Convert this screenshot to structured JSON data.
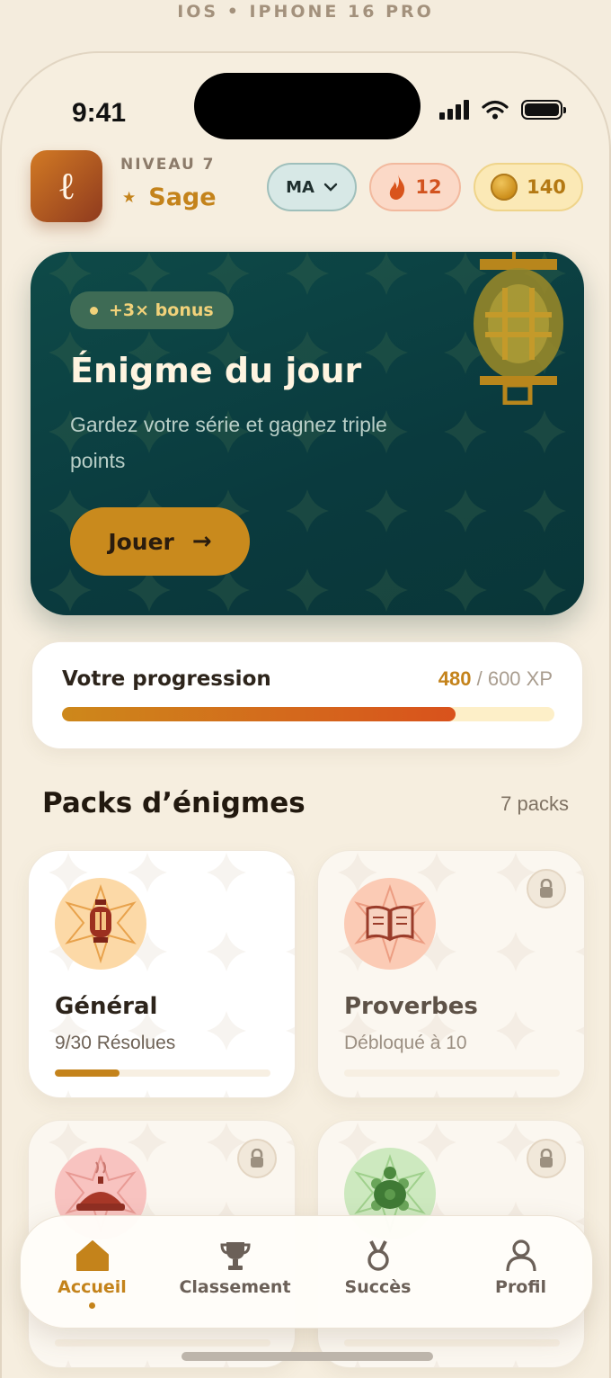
{
  "device_caption": "IOS • IPHONE 16 PRO",
  "status_bar": {
    "time": "9:41"
  },
  "header": {
    "avatar_letter": "ℓ",
    "level_label": "NIVEAU 7",
    "rank_star": "★",
    "rank_name": "Sage",
    "language": "MA",
    "streak": "12",
    "coins": "140"
  },
  "hero": {
    "badge": "+3× bonus",
    "title": "Énigme du jour",
    "subtitle": "Gardez votre série et gagnez triple points",
    "play_label": "Jouer",
    "play_arrow": "→"
  },
  "progress": {
    "title": "Votre progression",
    "current": "480",
    "separator": " / ",
    "total": "600 XP",
    "fraction": 0.8
  },
  "packs_section": {
    "title": "Packs d’énigmes",
    "count": "7 packs"
  },
  "packs": [
    {
      "name": "Général",
      "status": "9/30 Résolues",
      "progress": 0.3,
      "locked": false,
      "icon": "lantern-icon"
    },
    {
      "name": "Proverbes",
      "status": "Débloqué à 10",
      "progress": 0,
      "locked": true,
      "icon": "book-icon"
    },
    {
      "name": "",
      "status": "",
      "progress": 0,
      "locked": true,
      "icon": "tagine-icon"
    },
    {
      "name": "",
      "status": "",
      "progress": 0,
      "locked": true,
      "icon": "turtle-icon"
    }
  ],
  "tabbar": {
    "items": [
      {
        "label": "Accueil",
        "icon": "home-icon",
        "active": true
      },
      {
        "label": "Classement",
        "icon": "trophy-icon",
        "active": false
      },
      {
        "label": "Succès",
        "icon": "medal-icon",
        "active": false
      },
      {
        "label": "Profil",
        "icon": "user-icon",
        "active": false
      }
    ]
  },
  "colors": {
    "accent": "#c4831b",
    "hero_bg": "#0e4a48",
    "background": "#f6eedf",
    "streak": "#d2531f"
  }
}
